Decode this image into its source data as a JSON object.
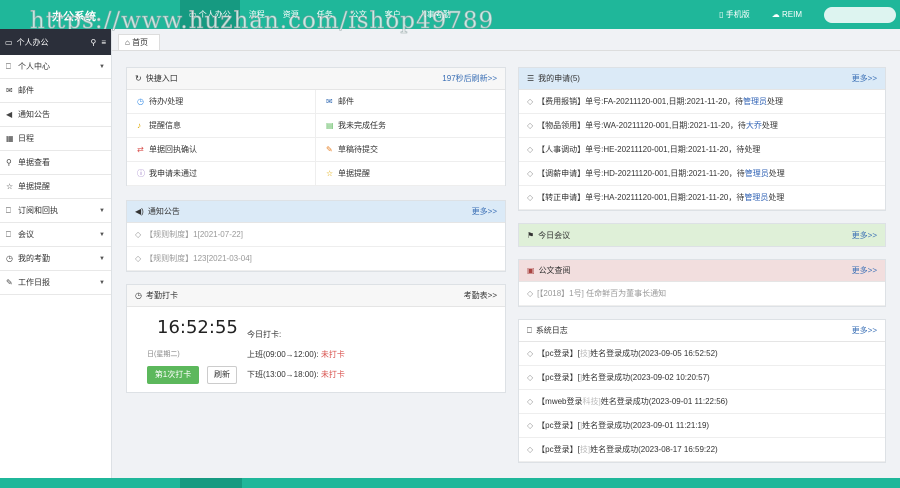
{
  "app": {
    "title": "办公系统",
    "watermark": "https://www.huzhan.com/ishop49789"
  },
  "top_nav": [
    {
      "label": "个人办公",
      "icon": "monitor-icon"
    },
    {
      "label": "流程"
    },
    {
      "label": "资源"
    },
    {
      "label": "任务"
    },
    {
      "label": "公文"
    },
    {
      "label": "客户"
    },
    {
      "label": "人事考勤"
    }
  ],
  "top_right": {
    "mobile": "手机版",
    "reim": "REIM"
  },
  "sidebar": {
    "header": "个人办公",
    "items": [
      {
        "label": "个人中心",
        "icon": "bookmark-icon",
        "caret": true
      },
      {
        "label": "邮件",
        "icon": "envelope-icon",
        "caret": false
      },
      {
        "label": "通知公告",
        "icon": "volume-icon",
        "caret": false
      },
      {
        "label": "日程",
        "icon": "calendar-icon",
        "caret": false
      },
      {
        "label": "单据查看",
        "icon": "search-icon",
        "caret": false
      },
      {
        "label": "单据提醒",
        "icon": "star-icon",
        "caret": false
      },
      {
        "label": "订阅和回执",
        "icon": "bookmark-icon",
        "caret": true
      },
      {
        "label": "会议",
        "icon": "bookmark-icon",
        "caret": true
      },
      {
        "label": "我的考勤",
        "icon": "clock-icon",
        "caret": true
      },
      {
        "label": "工作日报",
        "icon": "edit-icon",
        "caret": true
      }
    ]
  },
  "breadcrumb": "首页",
  "quick": {
    "title": "快捷入口",
    "refresh": "197秒后刷新>>",
    "items": [
      {
        "label": "待办/处理",
        "icon": "clock-icon",
        "color": "#3a8ee6"
      },
      {
        "label": "邮件",
        "icon": "envelope-icon",
        "color": "#3a6fb5"
      },
      {
        "label": "提醒信息",
        "icon": "bell-icon",
        "color": "#e0a800"
      },
      {
        "label": "我未完成任务",
        "icon": "book-icon",
        "color": "#5cb85c"
      },
      {
        "label": "单据回执确认",
        "icon": "exchange-icon",
        "color": "#d9534f"
      },
      {
        "label": "草稿待提交",
        "icon": "edit-icon",
        "color": "#e67e22"
      },
      {
        "label": "我申请未通过",
        "icon": "info-icon",
        "color": "#8e6bbf"
      },
      {
        "label": "单据提醒",
        "icon": "star-icon",
        "color": "#e0a800"
      }
    ]
  },
  "notice": {
    "title": "通知公告",
    "more": "更多>>",
    "items": [
      {
        "tag": "【规则制度】",
        "text": "1[2021-07-22]"
      },
      {
        "tag": "【规则制度】",
        "text": "123[2021-03-04]"
      }
    ]
  },
  "attendance": {
    "title": "考勤打卡",
    "more": "考勤表>>",
    "time": "16:52:55",
    "date": "日(星期二)",
    "today": "今日打卡:",
    "am_label": "上班(09:00→12:00):",
    "am_status": "未打卡",
    "pm_label": "下班(13:00→18:00):",
    "pm_status": "未打卡",
    "clock_btn": "第1次打卡",
    "refresh_btn": "刷新"
  },
  "applications": {
    "title": "我的申请(5)",
    "more": "更多>>",
    "items": [
      {
        "tag": "【费用报销】",
        "text": "单号:FA-20211120-001,日期:2021-11-20，待",
        "hl": "管理员",
        "tail": "处理"
      },
      {
        "tag": "【物品领用】",
        "text": "单号:WA-20211120-001,日期:2021-11-20，待",
        "hl": "大乔",
        "tail": "处理"
      },
      {
        "tag": "【人事调动】",
        "text": "单号:HE-20211120-001,日期:2021-11-20，待处理",
        "hl": "",
        "tail": ""
      },
      {
        "tag": "【调薪申请】",
        "text": "单号:HD-20211120-001,日期:2021-11-20，待",
        "hl": "管理员",
        "tail": "处理"
      },
      {
        "tag": "【转正申请】",
        "text": "单号:HA-20211120-001,日期:2021-11-20，待",
        "hl": "管理员",
        "tail": "处理"
      }
    ]
  },
  "meeting": {
    "title": "今日会议",
    "more": "更多>>"
  },
  "document": {
    "title": "公文查阅",
    "more": "更多>>",
    "items": [
      {
        "text": "[【2018】1号] 任命鲜百为董事长通知"
      }
    ]
  },
  "syslog": {
    "title": "系统日志",
    "more": "更多>>",
    "items": [
      {
        "tag": "【pc登录】",
        "text": "[ ",
        "blur": "技]",
        "tail": "姓名登录成功(2023-09-05 16:52:52)"
      },
      {
        "tag": "【pc登录】",
        "text": "[",
        "blur": "  ]",
        "tail": "姓名登录成功(2023-09-02 10:20:57)"
      },
      {
        "tag": "【mweb登录",
        "text": "",
        "blur": "科技]",
        "tail": "姓名登录成功(2023-09-01 11:22:56)"
      },
      {
        "tag": "【pc登录】",
        "text": "[",
        "blur": "  ]",
        "tail": "姓名登录成功(2023-09-01 11:21:19)"
      },
      {
        "tag": "【pc登录】",
        "text": "[",
        "blur": "技]",
        "tail": "姓名登录成功(2023-08-17 16:59:22)"
      }
    ]
  },
  "colors": {
    "brand": "#1fb79a",
    "brand_dark": "#169a81",
    "notice_head": "#dbeaf7",
    "meeting_head": "#dff0d8",
    "document_head": "#f2dede"
  }
}
